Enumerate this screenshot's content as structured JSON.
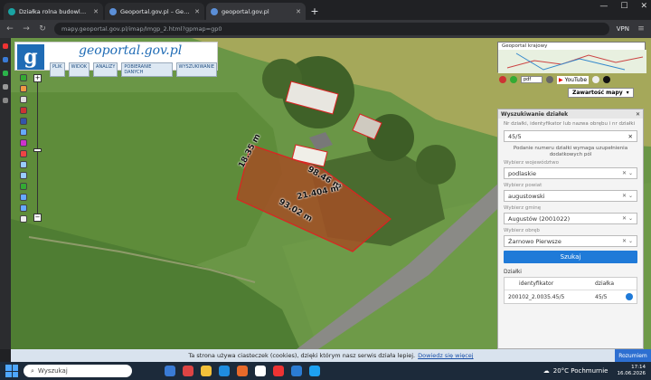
{
  "browser": {
    "tabs": [
      {
        "label": "Działka rolna budowlana Żarno",
        "active": false,
        "color": "#1aa3a3"
      },
      {
        "label": "Geoportal.gov.pl – Geoportal In",
        "active": false,
        "color": "#5b8fd8"
      },
      {
        "label": "geoportal.gov.pl",
        "active": true,
        "color": "#5b8fd8"
      }
    ],
    "url": "mapy.geoportal.gov.pl/imap/Imgp_2.html?gpmap=gp0",
    "url_host": "geoportal.gov.pl",
    "vpn_label": "VPN"
  },
  "geoportal": {
    "logo_letter": "g",
    "logo_name": "geoportal.gov.pl",
    "menu": [
      "PLIK",
      "WIDOK",
      "ANALIZY",
      "POBIERANIE DANYCH",
      "WYSZUKIWANIE"
    ],
    "overview_title": "Geoportal krajowy",
    "youtube_label": "YouTube",
    "contents_label": "Zawartość mapy"
  },
  "map_labels": {
    "side_a": "18.35 m",
    "side_b": "98.46 m",
    "area": "21.404 m²",
    "side_c": "93.02 m"
  },
  "search_panel": {
    "title": "Wyszukiwanie działek",
    "hint": "Nr działki, identyfikator lub nazwa obrębu i nr działki",
    "query": "45/5",
    "note": "Podanie numeru działki wymaga uzupełnienia dodatkowych pól",
    "voivodeship_label": "Wybierz województwo",
    "voivodeship": "podlaskie",
    "county_label": "Wybierz powiat",
    "county": "augustowski",
    "commune_label": "Wybierz gminę",
    "commune": "Augustów (2001022)",
    "precinct_label": "Wybierz obręb",
    "precinct": "Żarnowo Pierwsze",
    "search_button": "Szukaj",
    "results_label": "Działki",
    "col_id": "identyfikator",
    "col_parcel": "działka",
    "row_id": "200102_2.0035.45/5",
    "row_parcel": "45/5"
  },
  "cookie": {
    "text": "Ta strona używa ciasteczek (cookies), dzięki którym nasz serwis działa lepiej.",
    "link": "Dowiedz się więcej",
    "button": "Rozumiem"
  },
  "taskbar": {
    "search_placeholder": "Wyszukaj",
    "weather": "20°C  Pochmurnie",
    "time": "17:14",
    "date": "16.06.2026"
  }
}
